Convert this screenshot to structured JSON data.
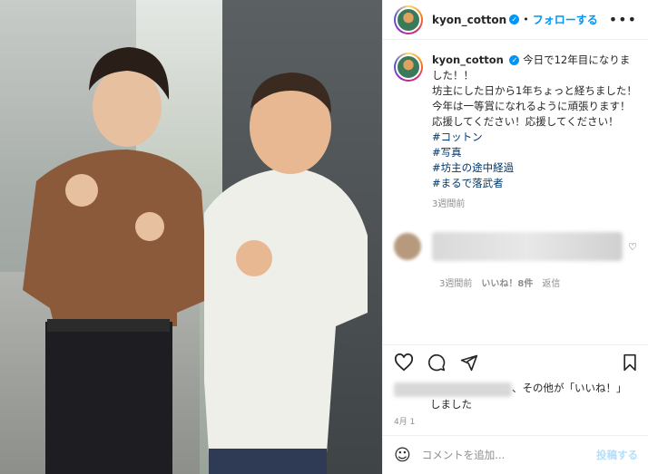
{
  "post": {
    "username": "kyon_cotton",
    "verified_icon": "verified-badge-icon",
    "dot": "•",
    "follow_label": "フォローする",
    "more_label": "•••"
  },
  "caption": {
    "username": "kyon_cotton",
    "lines": [
      "今日で12年目になりました！！",
      "坊主にした日から1年ちょっと経ちました！",
      "今年は一等賞になれるように頑張ります！",
      "応援してください！応援してください！"
    ],
    "hashtags": [
      "#コットン",
      "#写真",
      "#坊主の途中経過",
      "#まるで落武者"
    ],
    "time": "3週間前"
  },
  "comment": {
    "time": "3週間前",
    "likes": "いいね！8件",
    "reply": "返信"
  },
  "likes": {
    "suffix": "、その他が「いいね！」",
    "suffix2": "しました"
  },
  "date": "4月 1",
  "comment_box": {
    "placeholder": "コメントを追加...",
    "post_label": "投稿する"
  },
  "colors": {
    "accent": "#0095f6",
    "hashtag": "#00376b"
  }
}
